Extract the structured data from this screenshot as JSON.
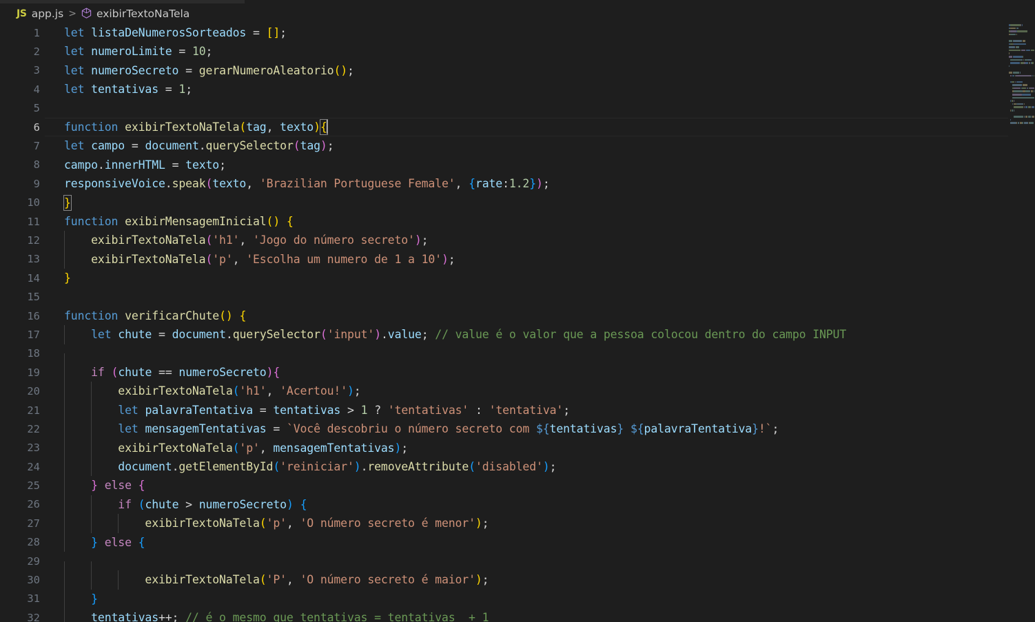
{
  "window": {
    "app": "Visual Studio Code",
    "theme": "Dark+",
    "background_color": "#1e1e1e"
  },
  "breadcrumb": {
    "js_badge": "JS",
    "file_name": "app.js",
    "separator": ">",
    "symbol_icon": "cube-icon",
    "symbol_name": "exibirTextoNaTela"
  },
  "editor": {
    "language": "javascript",
    "active_line": 6,
    "cursor": {
      "line": 6,
      "column": 52
    },
    "colors": {
      "keyword": "#569cd6",
      "control": "#c586c0",
      "variable": "#9cdcfe",
      "function": "#dcdcaa",
      "number": "#b5cea8",
      "string": "#ce9178",
      "comment": "#6a9955",
      "bracket1": "#ffd700",
      "bracket2": "#da70d6",
      "bracket3": "#179fff",
      "default_text": "#d4d4d4",
      "line_number": "#6e7681"
    },
    "line_numbers": [
      1,
      2,
      3,
      4,
      5,
      6,
      7,
      8,
      9,
      10,
      11,
      12,
      13,
      14,
      15,
      16,
      17,
      18,
      19,
      20,
      21,
      22,
      23,
      24,
      25,
      26,
      27,
      28,
      29,
      30,
      31,
      32
    ],
    "lines": [
      "let listaDeNumerosSorteados = [];",
      "let numeroLimite = 10;",
      "let numeroSecreto = gerarNumeroAleatorio();",
      "let tentativas = 1;",
      "",
      "function exibirTextoNaTela(tag, texto){",
      "let campo = document.querySelector(tag);",
      "campo.innerHTML = texto;",
      "responsiveVoice.speak(texto, 'Brazilian Portuguese Female', {rate:1.2});",
      "}",
      "function exibirMensagemInicial() {",
      "    exibirTextoNaTela('h1', 'Jogo do número secreto');",
      "    exibirTextoNaTela('p', 'Escolha um numero de 1 a 10');",
      "}",
      "",
      "function verificarChute() {",
      "    let chute = document.querySelector('input').value; // value é o valor que a pessoa colocou dentro do campo INPUT",
      "",
      "    if (chute == numeroSecreto){",
      "        exibirTextoNaTela('h1', 'Acertou!');",
      "        let palavraTentativa = tentativas > 1 ? 'tentativas' : 'tentativa';",
      "        let mensagemTentativas = `Você descobriu o número secreto com ${tentativas} ${palavraTentativa}!`;",
      "        exibirTextoNaTela('p', mensagemTentativas);",
      "        document.getElementById('reiniciar').removeAttribute('disabled');",
      "    } else {",
      "        if (chute > numeroSecreto) {",
      "            exibirTextoNaTela('p', 'O número secreto é menor');",
      "    } else {",
      "",
      "            exibirTextoNaTela('P', 'O número secreto é maior');",
      "    }",
      "    tentativas++; // é o mesmo que tentativas = tentativas  + 1"
    ]
  },
  "minimap": {
    "visible": true,
    "position": "right"
  }
}
